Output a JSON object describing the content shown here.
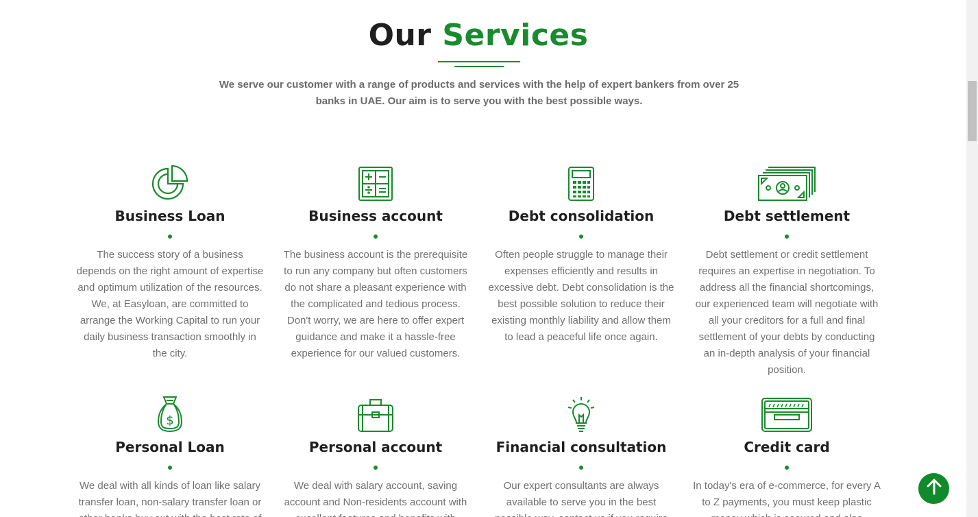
{
  "section": {
    "title_part1": "Our",
    "title_part2": "Services",
    "subtitle": "We serve our customer with a range of products and services with the help of expert bankers from over 25 banks in UAE. Our aim is to serve you with the best possible ways."
  },
  "colors": {
    "accent": "#1a8a2e",
    "heading": "#1f1f1f",
    "text": "#707070",
    "back_to_top": "#118a2c"
  },
  "services": [
    {
      "icon": "pie-chart-icon",
      "title": "Business Loan",
      "description": "The success story of a business depends on the right amount of expertise and optimum utilization of the resources. We, at Easyloan, are committed to arrange the Working Capital to run your daily business transaction smoothly in the city."
    },
    {
      "icon": "calculator-grid-icon",
      "title": "Business account",
      "description": "The business account is the prerequisite to run any company but often customers do not share a pleasant experience with the complicated and tedious process. Don't worry, we are here to offer expert guidance and make it a hassle-free experience for our valued customers."
    },
    {
      "icon": "calculator-icon",
      "title": "Debt consolidation",
      "description": "Often people struggle to manage their expenses efficiently and results in excessive debt. Debt consolidation is the best possible solution to reduce their existing monthly liability and allow them to lead a peaceful life once again."
    },
    {
      "icon": "banknotes-icon",
      "title": "Debt settlement",
      "description": "Debt settlement or credit settlement requires an expertise in negotiation. To address all the financial shortcomings, our experienced team will negotiate with all your creditors for a full and final settlement of your debts by conducting an in-depth analysis of your financial position."
    },
    {
      "icon": "money-bag-icon",
      "title": "Personal Loan",
      "description": "We deal with all kinds of loan like salary transfer loan, non-salary transfer loan or other banks buy out with the best rate of"
    },
    {
      "icon": "briefcase-icon",
      "title": "Personal account",
      "description": "We deal with salary account, saving account and Non-residents account with excellent features and benefits with"
    },
    {
      "icon": "lightbulb-icon",
      "title": "Financial consultation",
      "description": "Our expert consultants are always available to serve you in the best possible way, contact us if you require"
    },
    {
      "icon": "credit-card-icon",
      "title": "Credit card",
      "description": "In today's era of e-commerce, for every A to Z payments, you must keep plastic money which is secured and also"
    }
  ],
  "back_to_top": {
    "icon": "arrow-up-icon"
  }
}
